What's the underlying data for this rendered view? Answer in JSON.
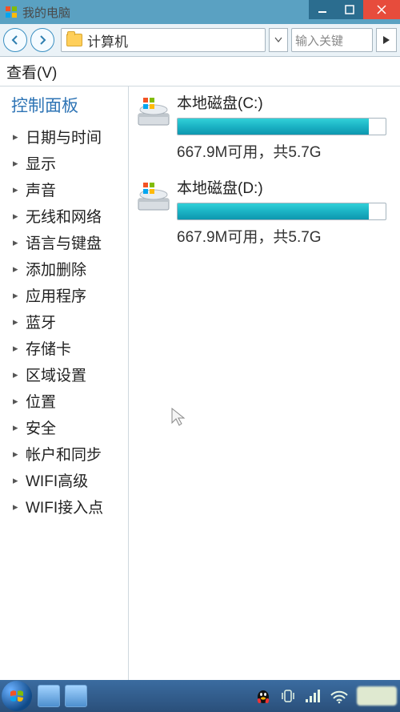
{
  "titlebar": {
    "title": "我的电脑"
  },
  "nav": {
    "address": "计算机",
    "search_placeholder": "输入关键"
  },
  "menu": {
    "view": "查看(V)"
  },
  "sidebar": {
    "title": "控制面板",
    "items": [
      "日期与时间",
      "显示",
      "声音",
      "无线和网络",
      "语言与键盘",
      "添加删除",
      "应用程序",
      "蓝牙",
      "存储卡",
      "区域设置",
      "位置",
      "安全",
      "帐户和同步",
      "WIFI高级",
      "WIFI接入点"
    ]
  },
  "drives": [
    {
      "name": "本地磁盘(C:)",
      "free": "667.9M可用，共5.7G",
      "fill_pct": 92
    },
    {
      "name": "本地磁盘(D:)",
      "free": "667.9M可用，共5.7G",
      "fill_pct": 92
    }
  ]
}
